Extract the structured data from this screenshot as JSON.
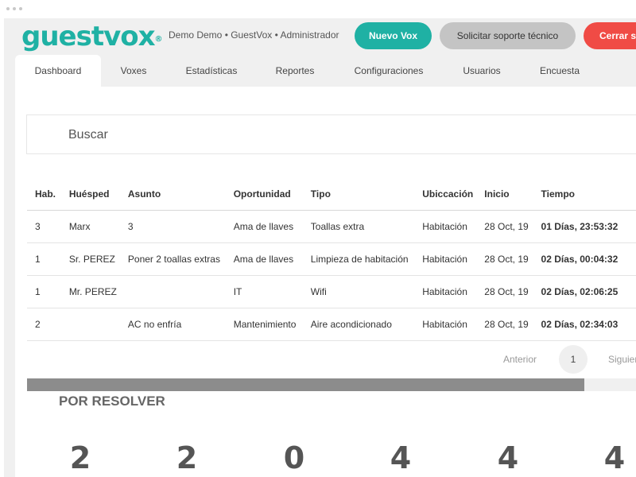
{
  "app": {
    "logo": "guestvox",
    "logo_mark": "®",
    "user_info": "Demo Demo • GuestVox • Administrador"
  },
  "header": {
    "nuevo_vox": "Nuevo Vox",
    "soporte": "Solicitar soporte técnico",
    "cerrar": "Cerrar sesión"
  },
  "tabs": [
    {
      "label": "Dashboard",
      "active": true
    },
    {
      "label": "Voxes"
    },
    {
      "label": "Estadísticas"
    },
    {
      "label": "Reportes"
    },
    {
      "label": "Configuraciones"
    },
    {
      "label": "Usuarios"
    },
    {
      "label": "Encuesta"
    }
  ],
  "search": {
    "placeholder": "Buscar"
  },
  "table": {
    "headers": [
      "Hab.",
      "Huésped",
      "Asunto",
      "Oportunidad",
      "Tipo",
      "Ubiccación",
      "Inicio",
      "Tiempo"
    ],
    "rows": [
      [
        "3",
        "Marx",
        "3",
        "Ama de llaves",
        "Toallas extra",
        "Habitación",
        "28 Oct, 19",
        "01 Días, 23:53:32"
      ],
      [
        "1",
        "Sr. PEREZ",
        "Poner 2 toallas extras",
        "Ama de llaves",
        "Limpieza de habitación",
        "Habitación",
        "28 Oct, 19",
        "02 Días, 00:04:32"
      ],
      [
        "1",
        "Mr. PEREZ",
        "",
        "IT",
        "Wifi",
        "Habitación",
        "28 Oct, 19",
        "02 Días, 02:06:25"
      ],
      [
        "2",
        "",
        "AC no enfría",
        "Mantenimiento",
        "Aire acondicionado",
        "Habitación",
        "28 Oct, 19",
        "02 Días, 02:34:03"
      ]
    ]
  },
  "pagination": {
    "prev": "Anterior",
    "current": "1",
    "next": "Siguiente"
  },
  "progress": {
    "fill_fraction": 0.91
  },
  "section": {
    "title": "POR RESOLVER"
  },
  "stats": [
    "2",
    "2",
    "0",
    "4",
    "4",
    "4"
  ],
  "colors": {
    "accent": "#1fb1a4",
    "danger": "#f04b45",
    "neutral_button": "#c4c4c4",
    "progress": "#8c8c8c"
  }
}
